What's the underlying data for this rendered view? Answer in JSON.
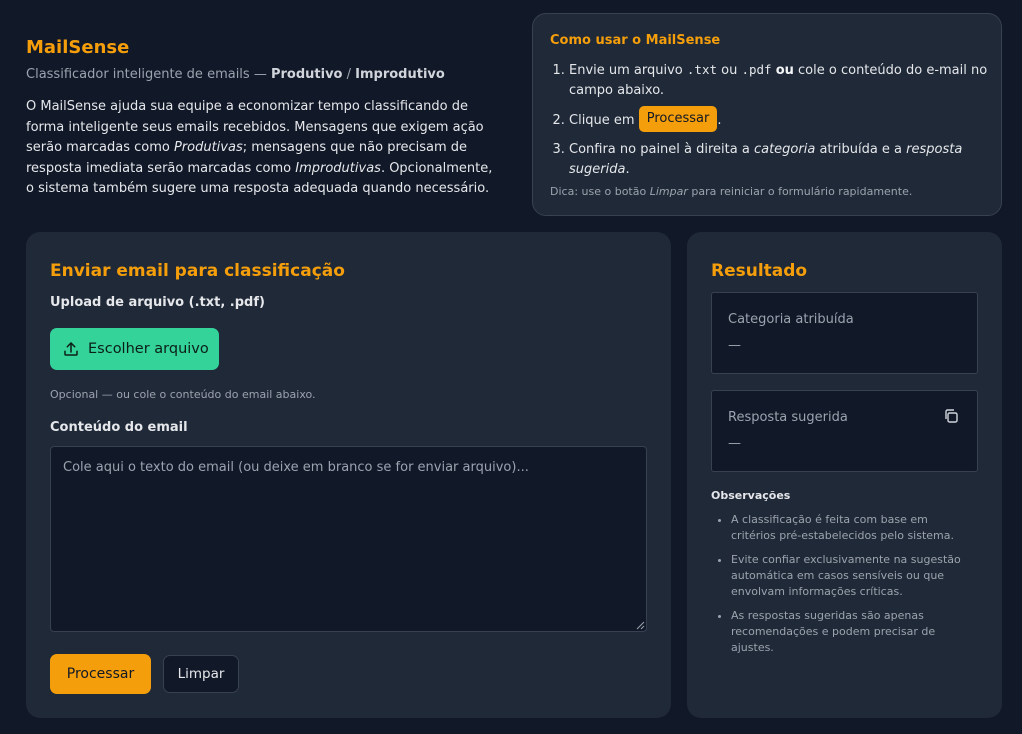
{
  "header": {
    "brand": "MailSense",
    "subtitle_prefix": "Classificador inteligente de emails — ",
    "subtitle_productive": "Produtivo",
    "subtitle_sep": " / ",
    "subtitle_unproductive": "Improdutivo",
    "intro_1": "O MailSense ajuda sua equipe a economizar tempo classificando de forma inteligente seus emails recebidos. Mensagens que exigem ação serão marcadas como ",
    "intro_productive": "Produtivas",
    "intro_2": "; mensagens que não precisam de resposta imediata serão marcadas como ",
    "intro_unproductive": "Improdutivas",
    "intro_3": ". Opcionalmente, o sistema também sugere uma resposta adequada quando necessário."
  },
  "howto": {
    "title": "Como usar o MailSense",
    "step1_a": "Envie um arquivo ",
    "step1_txt": ".txt",
    "step1_b": " ou ",
    "step1_pdf": ".pdf",
    "step1_or": "ou",
    "step1_c": " cole o conteúdo do e-mail no campo abaixo.",
    "step2_a": "Clique em ",
    "step2_chip": "Processar",
    "step2_b": ".",
    "step3_a": "Confira no painel à direita a ",
    "step3_category": "categoria",
    "step3_b": " atribuída e a ",
    "step3_suggested": "resposta sugerida",
    "step3_c": ".",
    "tip_a": "Dica: use o botão ",
    "tip_clear": "Limpar",
    "tip_b": " para reiniciar o formulário rapidamente."
  },
  "form": {
    "title": "Enviar email para classificação",
    "upload_label": "Upload de arquivo (.txt, .pdf)",
    "upload_button": "Escolher arquivo",
    "upload_icon": "upload-icon",
    "optional_hint": "Opcional — ou cole o conteúdo do email abaixo.",
    "content_label": "Conteúdo do email",
    "content_value": "",
    "content_placeholder": "Cole aqui o texto do email (ou deixe em branco se for enviar arquivo)...",
    "process_button": "Processar",
    "clear_button": "Limpar"
  },
  "result": {
    "title": "Resultado",
    "category_label": "Categoria atribuída",
    "category_value": "—",
    "suggested_label": "Resposta sugerida",
    "suggested_value": "—",
    "copy_icon": "copy-icon",
    "notes_title": "Observações",
    "notes": [
      "A classificação é feita com base em critérios pré-estabelecidos pelo sistema.",
      "Evite confiar exclusivamente na sugestão automática em casos sensíveis ou que envolvam informações críticas.",
      "As respostas sugeridas são apenas recomendações e podem precisar de ajustes."
    ]
  },
  "colors": {
    "background": "#111827",
    "card": "#1f2937",
    "accent": "#f59e0b",
    "success": "#34d399"
  }
}
